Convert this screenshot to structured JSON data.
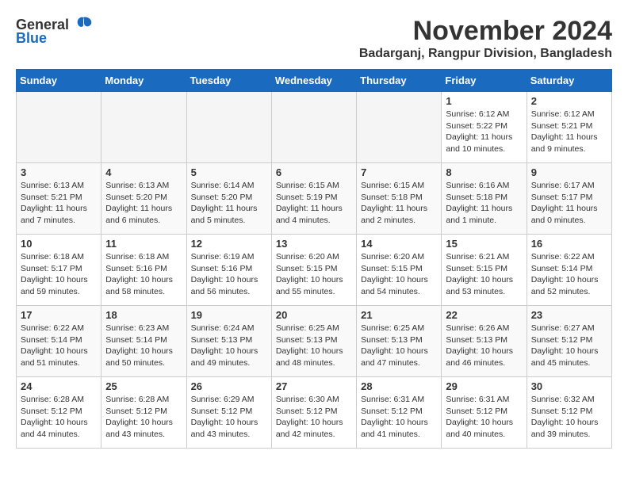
{
  "header": {
    "logo_general": "General",
    "logo_blue": "Blue",
    "month_title": "November 2024",
    "location": "Badarganj, Rangpur Division, Bangladesh"
  },
  "weekdays": [
    "Sunday",
    "Monday",
    "Tuesday",
    "Wednesday",
    "Thursday",
    "Friday",
    "Saturday"
  ],
  "weeks": [
    [
      {
        "day": "",
        "info": ""
      },
      {
        "day": "",
        "info": ""
      },
      {
        "day": "",
        "info": ""
      },
      {
        "day": "",
        "info": ""
      },
      {
        "day": "",
        "info": ""
      },
      {
        "day": "1",
        "info": "Sunrise: 6:12 AM\nSunset: 5:22 PM\nDaylight: 11 hours and 10 minutes."
      },
      {
        "day": "2",
        "info": "Sunrise: 6:12 AM\nSunset: 5:21 PM\nDaylight: 11 hours and 9 minutes."
      }
    ],
    [
      {
        "day": "3",
        "info": "Sunrise: 6:13 AM\nSunset: 5:21 PM\nDaylight: 11 hours and 7 minutes."
      },
      {
        "day": "4",
        "info": "Sunrise: 6:13 AM\nSunset: 5:20 PM\nDaylight: 11 hours and 6 minutes."
      },
      {
        "day": "5",
        "info": "Sunrise: 6:14 AM\nSunset: 5:20 PM\nDaylight: 11 hours and 5 minutes."
      },
      {
        "day": "6",
        "info": "Sunrise: 6:15 AM\nSunset: 5:19 PM\nDaylight: 11 hours and 4 minutes."
      },
      {
        "day": "7",
        "info": "Sunrise: 6:15 AM\nSunset: 5:18 PM\nDaylight: 11 hours and 2 minutes."
      },
      {
        "day": "8",
        "info": "Sunrise: 6:16 AM\nSunset: 5:18 PM\nDaylight: 11 hours and 1 minute."
      },
      {
        "day": "9",
        "info": "Sunrise: 6:17 AM\nSunset: 5:17 PM\nDaylight: 11 hours and 0 minutes."
      }
    ],
    [
      {
        "day": "10",
        "info": "Sunrise: 6:18 AM\nSunset: 5:17 PM\nDaylight: 10 hours and 59 minutes."
      },
      {
        "day": "11",
        "info": "Sunrise: 6:18 AM\nSunset: 5:16 PM\nDaylight: 10 hours and 58 minutes."
      },
      {
        "day": "12",
        "info": "Sunrise: 6:19 AM\nSunset: 5:16 PM\nDaylight: 10 hours and 56 minutes."
      },
      {
        "day": "13",
        "info": "Sunrise: 6:20 AM\nSunset: 5:15 PM\nDaylight: 10 hours and 55 minutes."
      },
      {
        "day": "14",
        "info": "Sunrise: 6:20 AM\nSunset: 5:15 PM\nDaylight: 10 hours and 54 minutes."
      },
      {
        "day": "15",
        "info": "Sunrise: 6:21 AM\nSunset: 5:15 PM\nDaylight: 10 hours and 53 minutes."
      },
      {
        "day": "16",
        "info": "Sunrise: 6:22 AM\nSunset: 5:14 PM\nDaylight: 10 hours and 52 minutes."
      }
    ],
    [
      {
        "day": "17",
        "info": "Sunrise: 6:22 AM\nSunset: 5:14 PM\nDaylight: 10 hours and 51 minutes."
      },
      {
        "day": "18",
        "info": "Sunrise: 6:23 AM\nSunset: 5:14 PM\nDaylight: 10 hours and 50 minutes."
      },
      {
        "day": "19",
        "info": "Sunrise: 6:24 AM\nSunset: 5:13 PM\nDaylight: 10 hours and 49 minutes."
      },
      {
        "day": "20",
        "info": "Sunrise: 6:25 AM\nSunset: 5:13 PM\nDaylight: 10 hours and 48 minutes."
      },
      {
        "day": "21",
        "info": "Sunrise: 6:25 AM\nSunset: 5:13 PM\nDaylight: 10 hours and 47 minutes."
      },
      {
        "day": "22",
        "info": "Sunrise: 6:26 AM\nSunset: 5:13 PM\nDaylight: 10 hours and 46 minutes."
      },
      {
        "day": "23",
        "info": "Sunrise: 6:27 AM\nSunset: 5:12 PM\nDaylight: 10 hours and 45 minutes."
      }
    ],
    [
      {
        "day": "24",
        "info": "Sunrise: 6:28 AM\nSunset: 5:12 PM\nDaylight: 10 hours and 44 minutes."
      },
      {
        "day": "25",
        "info": "Sunrise: 6:28 AM\nSunset: 5:12 PM\nDaylight: 10 hours and 43 minutes."
      },
      {
        "day": "26",
        "info": "Sunrise: 6:29 AM\nSunset: 5:12 PM\nDaylight: 10 hours and 43 minutes."
      },
      {
        "day": "27",
        "info": "Sunrise: 6:30 AM\nSunset: 5:12 PM\nDaylight: 10 hours and 42 minutes."
      },
      {
        "day": "28",
        "info": "Sunrise: 6:31 AM\nSunset: 5:12 PM\nDaylight: 10 hours and 41 minutes."
      },
      {
        "day": "29",
        "info": "Sunrise: 6:31 AM\nSunset: 5:12 PM\nDaylight: 10 hours and 40 minutes."
      },
      {
        "day": "30",
        "info": "Sunrise: 6:32 AM\nSunset: 5:12 PM\nDaylight: 10 hours and 39 minutes."
      }
    ]
  ]
}
